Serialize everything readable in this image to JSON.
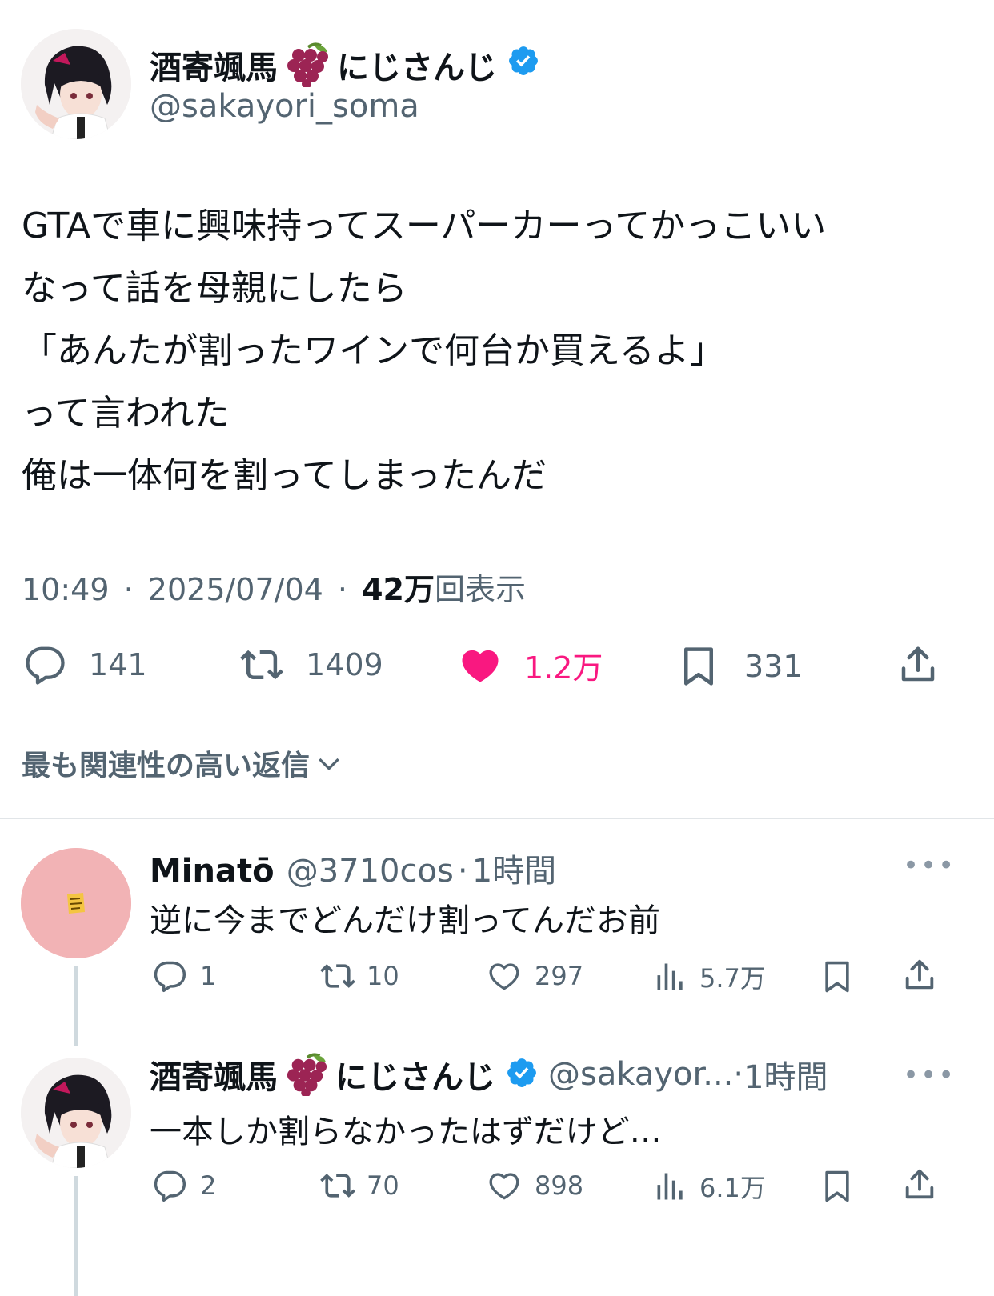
{
  "tweet": {
    "display_name": "酒寄颯馬",
    "name_suffix": "にじさんじ",
    "handle": "@sakayori_soma",
    "lines": [
      "GTAで車に興味持ってスーパーカーってかっこいい",
      "なって話を母親にしたら",
      "「あんたが割ったワインで何台か買えるよ」",
      "って言われた",
      "俺は一体何を割ってしまったんだ"
    ],
    "time": "10:49",
    "date": "2025/07/04",
    "views_count": "42万",
    "views_label": "回表示",
    "separator": "·",
    "replies": "141",
    "retweets": "1409",
    "likes": "1.2万",
    "bookmarks": "331"
  },
  "sort_label": "最も関連性の高い返信",
  "replies": [
    {
      "display_name": "Minatō",
      "handle": "@3710cos",
      "age": "1時間",
      "text": "逆に今までどんだけ割ってんだお前",
      "replies": "1",
      "retweets": "10",
      "likes": "297",
      "views": "5.7万"
    },
    {
      "display_name": "酒寄颯馬",
      "name_suffix": "にじさんじ",
      "handle": "@sakayor...",
      "age": "1時間",
      "text": "一本しか割らなかったはずだけど…",
      "replies": "2",
      "retweets": "70",
      "likes": "898",
      "views": "6.1万"
    }
  ],
  "more_glyph": "•••",
  "colors": {
    "text": "#0f1419",
    "secondary": "#536471",
    "like_active": "#f91880",
    "verified": "#1d9bf0",
    "reply_avatar_bg": "#f2b3b5"
  }
}
